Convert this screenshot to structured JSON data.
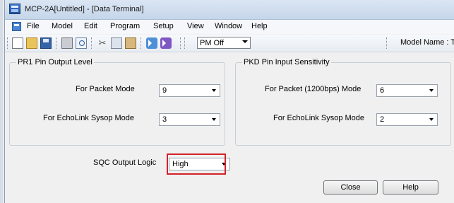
{
  "window": {
    "title": "MCP-2A[Untitled] - [Data Terminal]"
  },
  "menu": {
    "items": [
      "File",
      "Model",
      "Edit",
      "Program",
      "Setup",
      "View",
      "Window",
      "Help"
    ]
  },
  "toolbar": {
    "icons": [
      "new-icon",
      "open-icon",
      "save-icon",
      "print-icon",
      "print-preview-icon",
      "cut-icon",
      "copy-icon",
      "paste-icon",
      "read-radio-icon",
      "write-radio-icon"
    ],
    "pm_select_value": "PM Off",
    "model_name_label": "Model Name : TM"
  },
  "pr1_group": {
    "title": "PR1 Pin Output Level",
    "packet_label": "For Packet Mode",
    "packet_value": "9",
    "echolink_label": "For EchoLink Sysop Mode",
    "echolink_value": "3"
  },
  "pkd_group": {
    "title": "PKD Pin Input Sensitivity",
    "packet_label": "For Packet (1200bps) Mode",
    "packet_value": "6",
    "echolink_label": "For EchoLink Sysop Mode",
    "echolink_value": "2"
  },
  "sqc": {
    "label": "SQC Output Logic",
    "value": "High",
    "highlight_color": "#d3222a"
  },
  "buttons": {
    "close": "Close",
    "help": "Help"
  }
}
